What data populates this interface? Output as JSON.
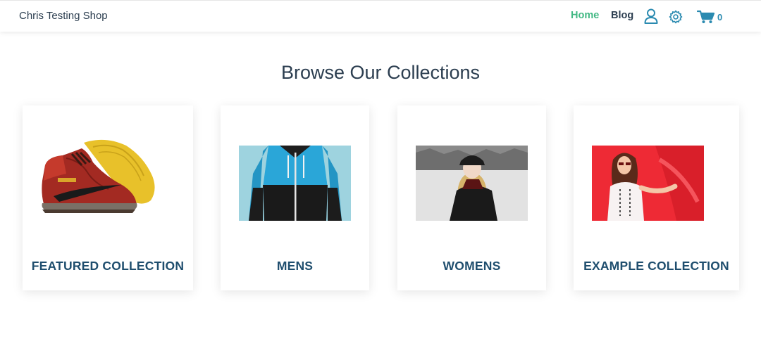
{
  "nav": {
    "brand": "Chris Testing Shop",
    "links": [
      {
        "label": "Home",
        "active": true
      },
      {
        "label": "Blog",
        "active": false
      }
    ],
    "icons": [
      "user-icon",
      "gear-icon",
      "cart-icon"
    ],
    "cart_count": "0",
    "accent_color": "#41b883"
  },
  "main": {
    "heading": "Browse Our Collections",
    "collections": [
      {
        "title": "FEATURED COLLECTION",
        "image": "sneaker"
      },
      {
        "title": "MENS",
        "image": "jacket"
      },
      {
        "title": "WOMENS",
        "image": "winter-portrait"
      },
      {
        "title": "EXAMPLE COLLECTION",
        "image": "red-portrait"
      }
    ]
  }
}
